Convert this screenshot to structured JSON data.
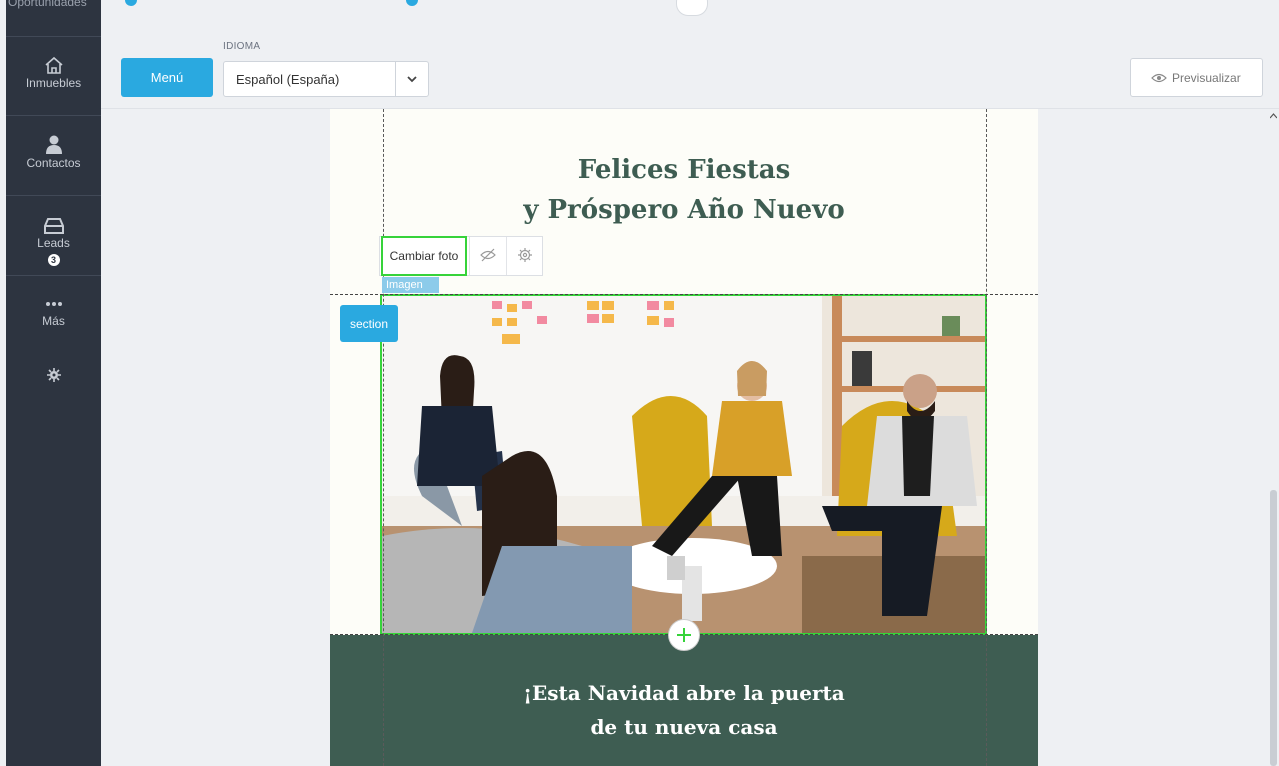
{
  "sidebar": {
    "partial_item": "Oportunidades",
    "items": [
      {
        "label": "Inmuebles",
        "icon": "home-icon"
      },
      {
        "label": "Contactos",
        "icon": "user-icon"
      },
      {
        "label": "Leads",
        "icon": "inbox-icon",
        "badge": "3"
      },
      {
        "label": "Más",
        "icon": "more-dots-icon"
      },
      {
        "label": "",
        "icon": "gear-icon"
      }
    ]
  },
  "toolbar": {
    "menu_label": "Menú",
    "language_label": "IDIOMA",
    "language_value": "Español (España)",
    "preview_label": "Previsualizar"
  },
  "editor": {
    "change_photo_label": "Cambiar foto",
    "image_tag": "Imagen",
    "section_label": "section"
  },
  "email": {
    "title_line1": "Felices Fiestas",
    "title_line2": "y Próspero Año Nuevo",
    "subtitle_line1": "¡Esta Navidad abre la puerta",
    "subtitle_line2": "de tu nueva casa"
  },
  "colors": {
    "accent": "#2aa9e0",
    "selection": "#36d33a",
    "email_green": "#3e5d52",
    "sidebar": "#2d3440"
  }
}
